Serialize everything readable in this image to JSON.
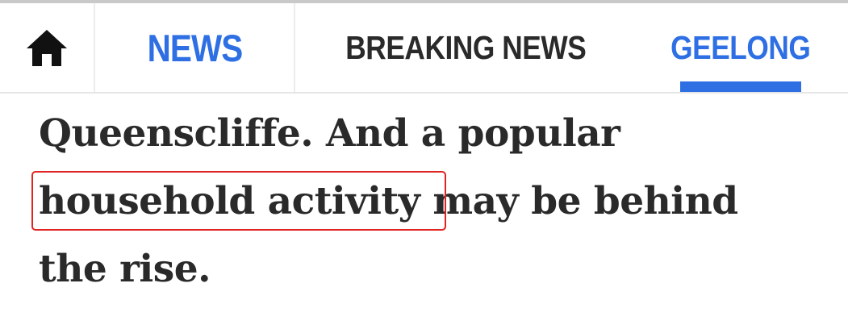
{
  "nav": {
    "home_icon": "home-icon",
    "items": [
      {
        "label": "NEWS"
      },
      {
        "label": "BREAKING NEWS"
      },
      {
        "label": "GEELONG"
      }
    ],
    "active_item": "GEELONG",
    "accent_color": "#2f6fe4"
  },
  "article": {
    "line1": "Queenscliffe. And a popular",
    "highlighted_phrase": "household activity",
    "line2_rest": " may be behind",
    "line3": "the rise."
  },
  "highlight_color": "#e02424"
}
